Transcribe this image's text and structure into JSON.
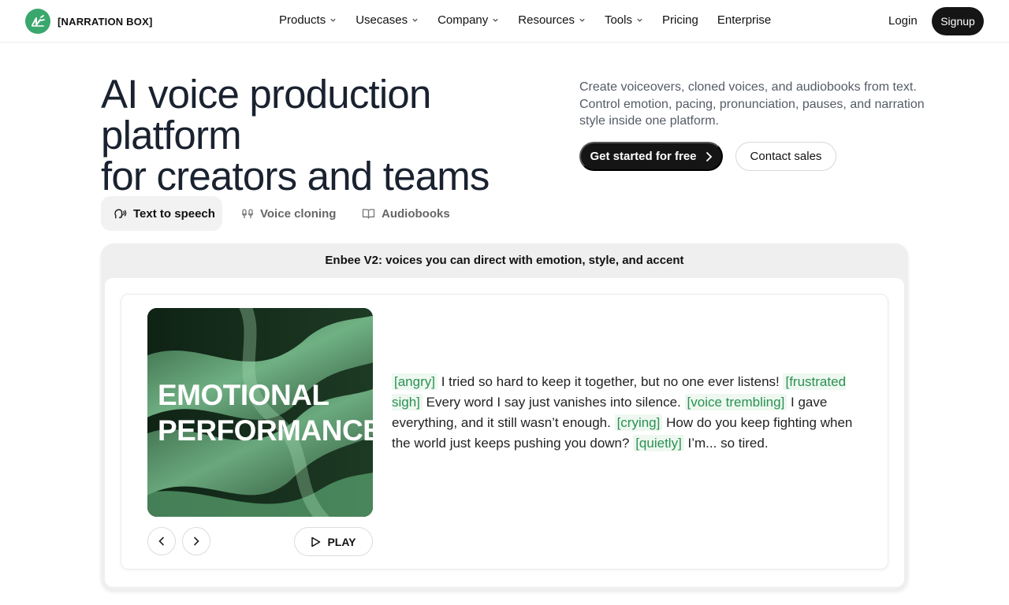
{
  "brand": {
    "name": "[NARRATION BOX]",
    "icon": "narration-logo-icon",
    "accent": "#3aa76d"
  },
  "nav": {
    "items": [
      {
        "label": "Products",
        "dropdown": true
      },
      {
        "label": "Usecases",
        "dropdown": true
      },
      {
        "label": "Company",
        "dropdown": true
      },
      {
        "label": "Resources",
        "dropdown": true
      },
      {
        "label": "Tools",
        "dropdown": true
      },
      {
        "label": "Pricing",
        "dropdown": false
      },
      {
        "label": "Enterprise",
        "dropdown": false
      }
    ],
    "login": "Login",
    "signup": "Signup"
  },
  "hero": {
    "title_line1": "AI voice production platform",
    "title_line2": "for creators and teams",
    "subtitle": "Create voiceovers, cloned voices, and audiobooks from text. Control emotion, pacing, pronunciation, pauses, and narration style inside one platform.",
    "cta_primary": "Get started for free",
    "cta_secondary": "Contact sales"
  },
  "tabs": [
    {
      "label": "Text to speech",
      "icon": "speaking-head-icon",
      "active": true
    },
    {
      "label": "Voice cloning",
      "icon": "voice-clone-icon",
      "active": false
    },
    {
      "label": "Audiobooks",
      "icon": "open-book-icon",
      "active": false
    }
  ],
  "demo": {
    "title": "Enbee V2: voices you can direct with emotion, style, and accent",
    "art_label": "Emotional Performance",
    "play_label": "PLAY",
    "tag_color": "#2a9152",
    "script": [
      {
        "type": "tag",
        "text": "[angry]"
      },
      {
        "type": "text",
        "text": " I tried so hard to keep it together, but no one ever listens! "
      },
      {
        "type": "tag",
        "text": "[frustrated sigh]"
      },
      {
        "type": "text",
        "text": " Every word I say just vanishes into silence. "
      },
      {
        "type": "tag",
        "text": "[voice trembling]"
      },
      {
        "type": "text",
        "text": " I gave everything, and it still wasn’t enough. "
      },
      {
        "type": "tag",
        "text": "[crying]"
      },
      {
        "type": "text",
        "text": " How do you keep fighting when the world just keeps pushing you down? "
      },
      {
        "type": "tag",
        "text": "[quietly]"
      },
      {
        "type": "text",
        "text": " I’m... so tired."
      }
    ]
  }
}
